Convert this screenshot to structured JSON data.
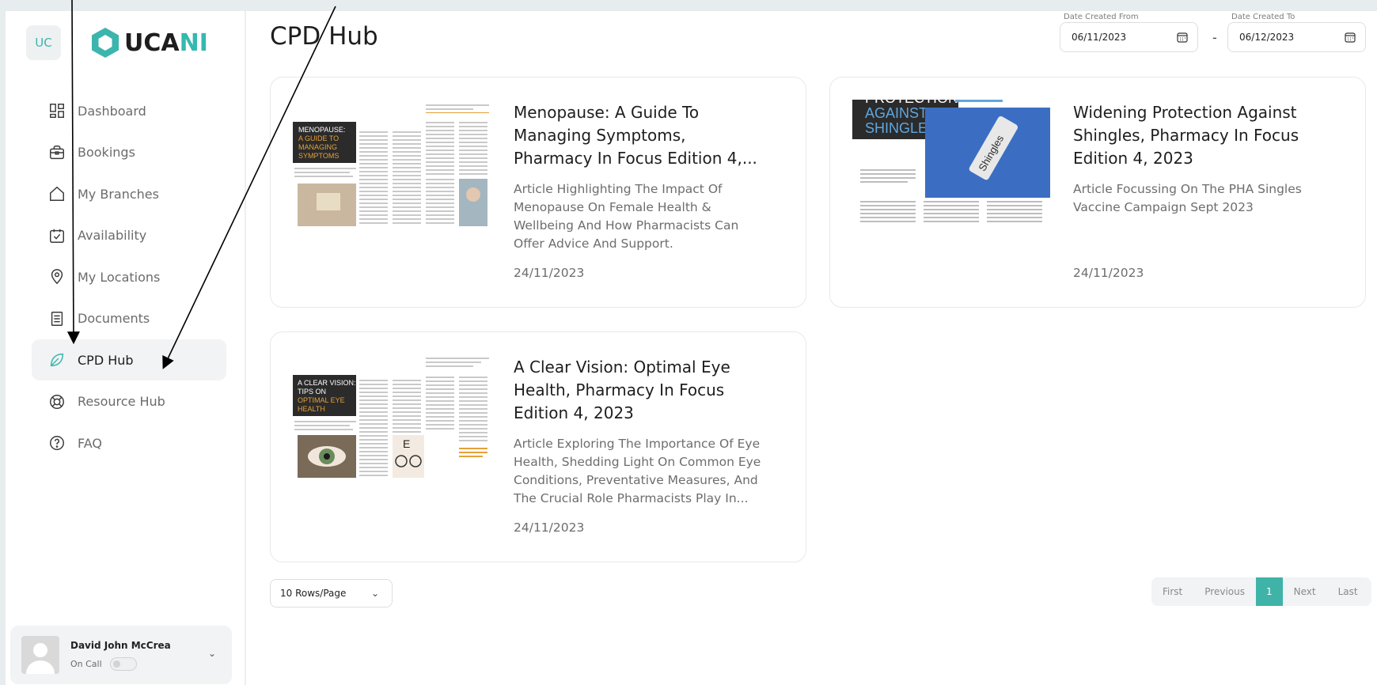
{
  "app": {
    "badge": "UC",
    "logo": {
      "prefix": "UCA",
      "suffix": "NI"
    },
    "page_title": "CPD Hub"
  },
  "sidebar": {
    "items": [
      {
        "label": "Dashboard",
        "icon": "dashboard-icon"
      },
      {
        "label": "Bookings",
        "icon": "briefcase-icon"
      },
      {
        "label": "My Branches",
        "icon": "home-icon"
      },
      {
        "label": "Availability",
        "icon": "calendar-check-icon"
      },
      {
        "label": "My Locations",
        "icon": "location-pin-icon"
      },
      {
        "label": "Documents",
        "icon": "document-icon"
      },
      {
        "label": "CPD Hub",
        "icon": "leaf-icon",
        "active": true
      },
      {
        "label": "Resource Hub",
        "icon": "lifebuoy-icon"
      },
      {
        "label": "FAQ",
        "icon": "question-icon"
      }
    ]
  },
  "user": {
    "name": "David John McCrea",
    "status": "On Call"
  },
  "filters": {
    "from_label": "Date Created From",
    "from_value": "06/11/2023",
    "separator": "-",
    "to_label": "Date Created To",
    "to_value": "06/12/2023"
  },
  "articles": [
    {
      "title": "Menopause: A Guide To Managing Symptoms, Pharmacy In Focus Edition 4,...",
      "description": "Article Highlighting The Impact Of Menopause On Female Health & Wellbeing And How Pharmacists Can Offer Advice And Support.",
      "date": "24/11/2023",
      "thumb": {
        "heading_a": "MENOPAUSE:",
        "heading_b": "A GUIDE TO",
        "heading_c": "MANAGING",
        "heading_d": "SYMPTOMS"
      }
    },
    {
      "title": "Widening Protection Against Shingles, Pharmacy In Focus Edition 4, 2023",
      "description": "Article Focussing On The PHA Singles Vaccine Campaign Sept 2023",
      "date": "24/11/2023",
      "thumb": {
        "heading_a": "PROTECTION",
        "heading_b": "AGAINST",
        "heading_c": "SHINGLES",
        "label": "Shingles"
      }
    },
    {
      "title": "A Clear Vision: Optimal Eye Health, Pharmacy In Focus Edition 4, 2023",
      "description": "Article Exploring The Importance Of Eye Health, Shedding Light On Common Eye Conditions, Preventative Measures, And The Crucial Role Pharmacists Play In...",
      "date": "24/11/2023",
      "thumb": {
        "heading_a": "A CLEAR VISION:",
        "heading_b": "TIPS ON",
        "heading_c": "OPTIMAL EYE",
        "heading_d": "HEALTH"
      }
    }
  ],
  "pagination": {
    "rows_per_page": "10 Rows/Page",
    "first": "First",
    "previous": "Previous",
    "current": "1",
    "next": "Next",
    "last": "Last"
  },
  "colors": {
    "accent": "#3fb3a8",
    "menopause_orange": "#e5a13a",
    "shingles_blue": "#5fa7e0"
  }
}
